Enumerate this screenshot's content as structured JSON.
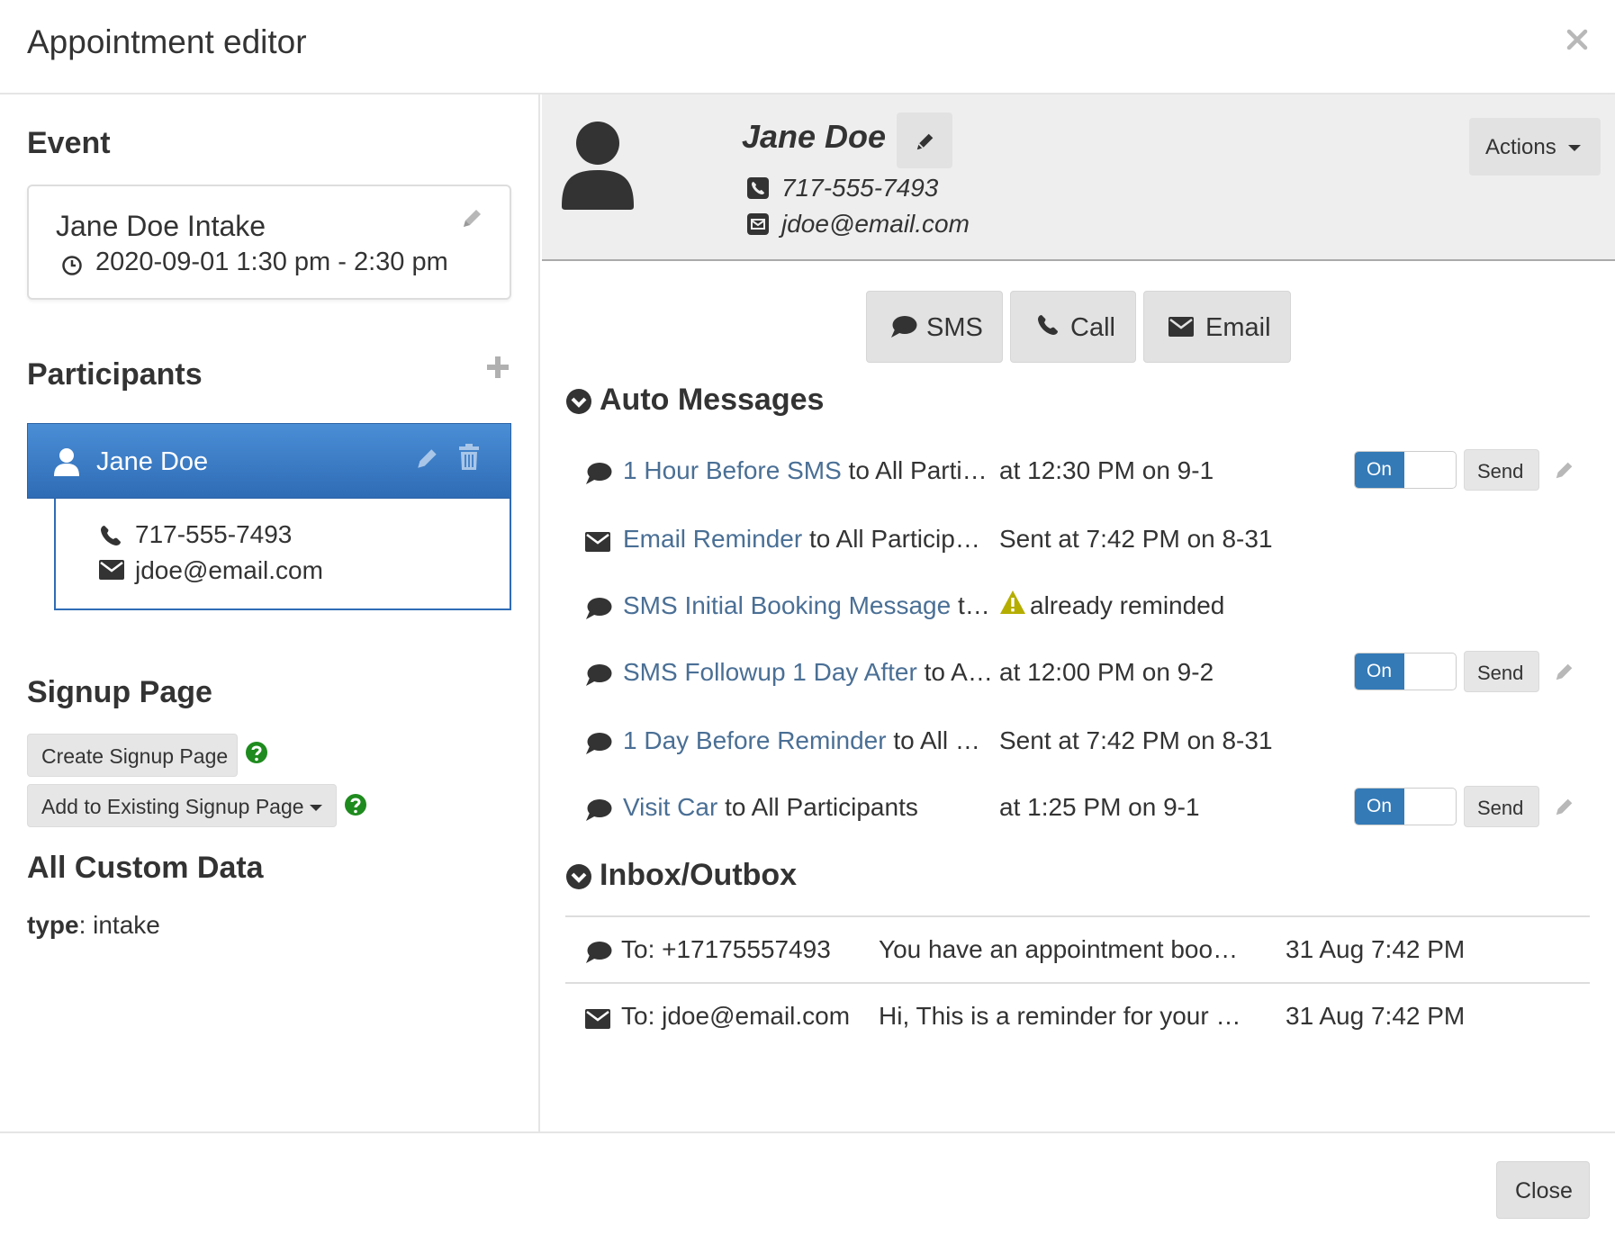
{
  "dialog": {
    "title": "Appointment editor",
    "close_label": "Close"
  },
  "event": {
    "heading": "Event",
    "name": "Jane Doe Intake",
    "time": "2020-09-01 1:30 pm - 2:30 pm"
  },
  "participants": {
    "heading": "Participants",
    "items": [
      {
        "name": "Jane Doe",
        "phone": "717-555-7493",
        "email": "jdoe@email.com"
      }
    ]
  },
  "signup": {
    "heading": "Signup Page",
    "create_label": "Create Signup Page",
    "add_existing_label": "Add to Existing Signup Page"
  },
  "custom_data": {
    "heading": "All Custom Data",
    "items": [
      {
        "key": "type",
        "value": "intake"
      }
    ]
  },
  "contact": {
    "name": "Jane Doe",
    "phone": "717-555-7493",
    "email": "jdoe@email.com",
    "actions_label": "Actions"
  },
  "quick_actions": {
    "sms": "SMS",
    "call": "Call",
    "email": "Email"
  },
  "auto_messages": {
    "heading": "Auto Messages",
    "items": [
      {
        "icon": "comment-icon",
        "name": "1 Hour Before SMS",
        "rest": " to All Participants",
        "when": "at 12:30 PM on 9-1",
        "toggle": "On",
        "send": "Send"
      },
      {
        "icon": "envelope-icon",
        "name": "Email Reminder",
        "rest": " to All Participants",
        "when": "Sent at 7:42 PM on 8-31"
      },
      {
        "icon": "comment-icon",
        "name": "SMS Initial Booking Message",
        "rest": " to All Participants",
        "warning": "already reminded"
      },
      {
        "icon": "comment-icon",
        "name": "SMS Followup 1 Day After",
        "rest": " to All Participants",
        "when": "at 12:00 PM on 9-2",
        "toggle": "On",
        "send": "Send"
      },
      {
        "icon": "comment-icon",
        "name": "1 Day Before Reminder",
        "rest": " to All Participants",
        "when": "Sent at 7:42 PM on 8-31"
      },
      {
        "icon": "comment-icon",
        "name": "Visit Car",
        "rest": " to All Participants",
        "when": "at 1:25 PM on 9-1",
        "toggle": "On",
        "send": "Send"
      }
    ]
  },
  "inbox": {
    "heading": "Inbox/Outbox",
    "items": [
      {
        "icon": "comment-icon",
        "to": "To: +17175557493",
        "message": "You have an appointment booked at Car…",
        "date": "31 Aug 7:42 PM"
      },
      {
        "icon": "envelope-icon",
        "to": "To: jdoe@email.com",
        "message": "Hi, This is a reminder for your appointme…",
        "date": "31 Aug 7:42 PM"
      }
    ]
  },
  "colors": {
    "link": "#4a6f95",
    "primary": "#337ab7",
    "help": "#1e8b1e",
    "warning": "#b5ad00"
  }
}
